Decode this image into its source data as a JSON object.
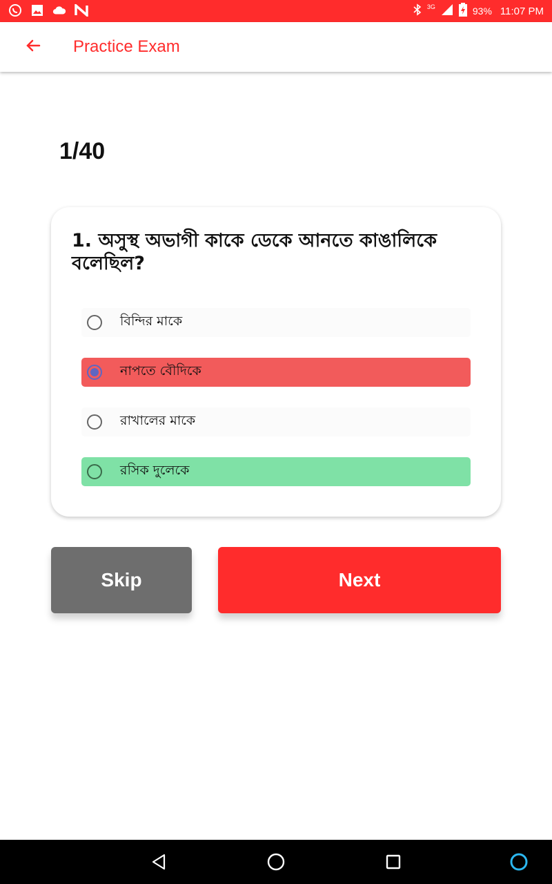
{
  "status_bar": {
    "network": "3G",
    "battery": "93%",
    "time": "11:07 PM",
    "left_icons": [
      "whatsapp-icon",
      "image-icon",
      "cloud-icon",
      "n-app-icon"
    ],
    "right_icons": [
      "bluetooth-icon",
      "signal-icon",
      "battery-charging-icon"
    ]
  },
  "app_bar": {
    "title": "Practice Exam",
    "back_icon": "arrow-left-icon"
  },
  "exam": {
    "counter": "1/40",
    "question": "1. অসুস্থ অভাগী কাকে ডেকে আনতে কাঙালিকে বলেছিল?",
    "options": [
      {
        "label": "বিন্দির মাকে",
        "state": "unselected"
      },
      {
        "label": "নাপতে বৌদিকে",
        "state": "selected-wrong"
      },
      {
        "label": "রাখালের মাকে",
        "state": "unselected"
      },
      {
        "label": "রসিক দুলেকে",
        "state": "correct"
      }
    ]
  },
  "actions": {
    "skip_label": "Skip",
    "next_label": "Next"
  },
  "nav_bar": {
    "icons": [
      "back-triangle-icon",
      "home-circle-icon",
      "recents-square-icon",
      "assistant-icon"
    ]
  },
  "colors": {
    "accent": "#ff2c2c",
    "wrong": "#f25b5b",
    "correct": "#7fe1a6",
    "skip": "#6e6e6e",
    "radio_selected": "#5f66c2"
  }
}
